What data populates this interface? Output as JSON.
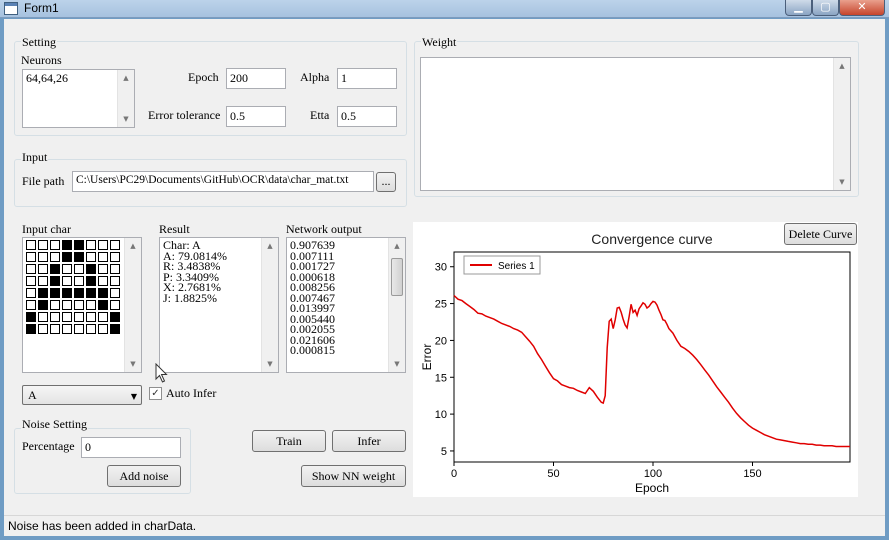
{
  "window": {
    "title": "Form1",
    "min_icon": "minimize-icon",
    "max_icon": "maximize-icon",
    "close_icon": "close-icon"
  },
  "setting": {
    "label": "Setting",
    "neurons_label": "Neurons",
    "neurons_value": "64,64,26",
    "epoch_label": "Epoch",
    "epoch_value": "200",
    "alpha_label": "Alpha",
    "alpha_value": "1",
    "error_tol_label": "Error tolerance",
    "error_tol_value": "0.5",
    "etta_label": "Etta",
    "etta_value": "0.5"
  },
  "weight": {
    "label": "Weight"
  },
  "input": {
    "label": "Input",
    "file_path_label": "File path",
    "file_path_value": "C:\\Users\\PC29\\Documents\\GitHub\\OCR\\data\\char_mat.txt",
    "browse_label": "..."
  },
  "input_char": {
    "label": "Input char",
    "grid": [
      [
        0,
        0,
        0,
        1,
        1,
        0,
        0,
        0
      ],
      [
        0,
        0,
        0,
        1,
        1,
        0,
        0,
        0
      ],
      [
        0,
        0,
        1,
        0,
        0,
        1,
        0,
        0
      ],
      [
        0,
        0,
        1,
        0,
        0,
        1,
        0,
        0
      ],
      [
        0,
        1,
        1,
        1,
        1,
        1,
        1,
        0
      ],
      [
        0,
        1,
        0,
        0,
        0,
        0,
        1,
        0
      ],
      [
        1,
        0,
        0,
        0,
        0,
        0,
        0,
        1
      ],
      [
        1,
        0,
        0,
        0,
        0,
        0,
        0,
        1
      ]
    ],
    "selected_char": "A",
    "auto_infer_label": "Auto Infer",
    "auto_infer_checked": true
  },
  "result": {
    "label": "Result",
    "lines": [
      "Char: A",
      "A: 79.0814%",
      "R: 3.4838%",
      "P: 3.3409%",
      "X: 2.7681%",
      "J: 1.8825%"
    ]
  },
  "network_output": {
    "label": "Network output",
    "values": [
      "0.907639",
      "0.007111",
      "0.001727",
      "0.000618",
      "0.008256",
      "0.007467",
      "0.013997",
      "0.005440",
      "0.002055",
      "0.021606",
      "0.000815"
    ]
  },
  "noise": {
    "label": "Noise Setting",
    "percentage_label": "Percentage",
    "percentage_value": "0",
    "add_noise_label": "Add noise"
  },
  "buttons": {
    "train": "Train",
    "infer": "Infer",
    "show_nn_weight": "Show NN weight",
    "delete_curve": "Delete Curve"
  },
  "status": {
    "text": "Noise has been added in charData."
  },
  "colors": {
    "series": "#e00000",
    "form_bg": "#f0f0f0",
    "title_bg": "#a6c2df"
  },
  "chart_data": {
    "type": "line",
    "title": "Convergence curve",
    "xlabel": "Epoch",
    "ylabel": "Error",
    "xlim": [
      0,
      199
    ],
    "ylim": [
      3.5,
      32
    ],
    "xticks": [
      0,
      50,
      100,
      150
    ],
    "yticks": [
      5,
      10,
      15,
      20,
      25,
      30
    ],
    "legend_position": "top-left",
    "series": [
      {
        "name": "Series 1",
        "color": "#e00000",
        "x": [
          0,
          2,
          4,
          6,
          8,
          10,
          12,
          14,
          16,
          18,
          20,
          22,
          24,
          26,
          28,
          30,
          32,
          34,
          36,
          38,
          40,
          42,
          44,
          46,
          48,
          50,
          52,
          54,
          56,
          58,
          60,
          62,
          64,
          66,
          68,
          70,
          72,
          74,
          75,
          76,
          77,
          78,
          79,
          80,
          81,
          82,
          83,
          84,
          85,
          86,
          87,
          88,
          89,
          90,
          91,
          92,
          93,
          94,
          95,
          96,
          97,
          98,
          99,
          100,
          101,
          102,
          103,
          104,
          105,
          106,
          107,
          108,
          110,
          112,
          114,
          116,
          118,
          120,
          122,
          124,
          126,
          128,
          130,
          132,
          134,
          136,
          138,
          140,
          142,
          144,
          146,
          148,
          150,
          152,
          154,
          156,
          158,
          160,
          162,
          164,
          166,
          168,
          170,
          172,
          174,
          176,
          178,
          180,
          182,
          184,
          186,
          188,
          190,
          192,
          194,
          196,
          198,
          199
        ],
        "y": [
          26.1,
          25.6,
          25.4,
          25.0,
          24.6,
          24.2,
          23.7,
          23.6,
          23.3,
          23.1,
          22.9,
          22.6,
          22.3,
          22.1,
          21.9,
          21.6,
          21.4,
          21.1,
          20.5,
          19.9,
          19.2,
          18.2,
          17.4,
          16.5,
          15.6,
          14.8,
          14.5,
          14.0,
          13.8,
          13.6,
          13.5,
          13.2,
          13.0,
          12.8,
          13.6,
          13.1,
          12.3,
          11.6,
          11.5,
          12.5,
          19.0,
          22.6,
          22.9,
          21.6,
          22.8,
          24.4,
          24.5,
          23.8,
          22.9,
          22.1,
          21.7,
          23.2,
          24.9,
          23.8,
          24.1,
          23.4,
          24.3,
          24.7,
          25.1,
          24.9,
          24.4,
          24.6,
          25.0,
          25.3,
          25.2,
          24.8,
          24.1,
          23.5,
          22.8,
          22.7,
          22.2,
          21.6,
          21.0,
          20.0,
          19.2,
          18.9,
          18.5,
          18.0,
          17.4,
          16.7,
          16.0,
          15.3,
          14.5,
          13.7,
          13.0,
          12.3,
          11.6,
          10.8,
          10.1,
          9.5,
          9.0,
          8.5,
          8.1,
          7.8,
          7.5,
          7.2,
          7.0,
          6.8,
          6.6,
          6.5,
          6.4,
          6.3,
          6.2,
          6.1,
          6.0,
          6.0,
          5.9,
          5.9,
          5.8,
          5.8,
          5.7,
          5.7,
          5.7,
          5.6,
          5.6,
          5.6,
          5.6,
          5.6
        ]
      }
    ]
  }
}
